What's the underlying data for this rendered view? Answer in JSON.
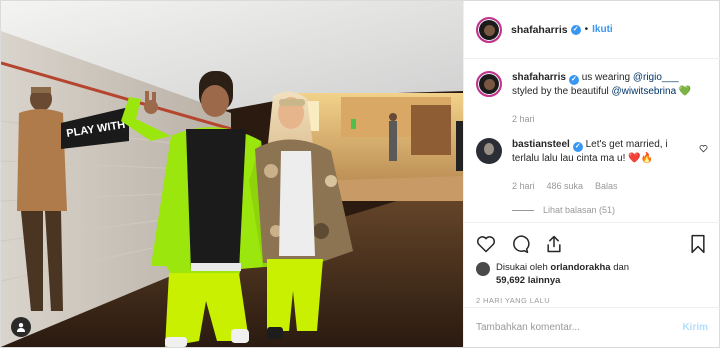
{
  "header": {
    "username": "shafaharris",
    "separator": "•",
    "follow_label": "Ikuti"
  },
  "caption": {
    "username": "shafaharris",
    "text_prefix": "us wearing",
    "mention_1": "@rigio___",
    "text_mid": "styled by the beautiful",
    "mention_2": "@wiwitsebrina",
    "emoji": "💚",
    "time": "2 hari"
  },
  "comment": {
    "username": "bastiansteel",
    "text": "Let's get married, i terlalu lalu lau cinta ma u!",
    "emoji": "❤️🔥",
    "time": "2 hari",
    "likes": "486 suka",
    "reply_label": "Balas",
    "view_replies": "Lihat balasan (51)"
  },
  "likes": {
    "prefix": "Disukai oleh",
    "user": "orlandorakha",
    "conjunction": "dan",
    "count": "59,692 lainnya"
  },
  "timestamp": "2 HARI YANG LALU",
  "add_comment": {
    "placeholder": "Tambahkan komentar...",
    "post_label": "Kirim"
  },
  "photo": {
    "sign_text": "PLAY WITH",
    "jacket_color": "#9be60c",
    "pants_color": "#c8f000"
  },
  "colors": {
    "link": "#3897f0",
    "mention": "#003569",
    "muted": "#999999",
    "story_ring": "#c1348f"
  },
  "icons": [
    "heart-icon",
    "comment-icon",
    "share-icon",
    "bookmark-icon",
    "verified-badge-icon",
    "user-tag-icon"
  ]
}
